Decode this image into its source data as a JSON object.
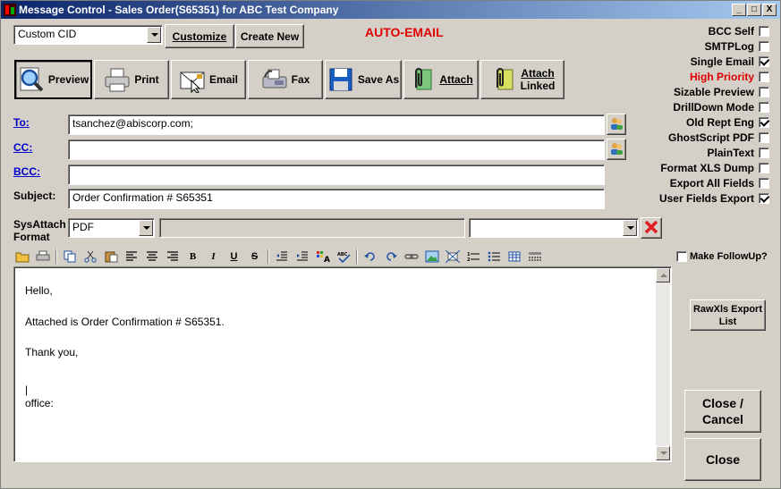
{
  "window": {
    "title": "Message Control - Sales Order(S65351) for ABC Test Company",
    "minimize": "_",
    "maximize": "□",
    "close": "X"
  },
  "top": {
    "cid_select": "Custom CID",
    "customize_label": "Customize",
    "create_new_label": "Create New",
    "auto_email": "AUTO-EMAIL"
  },
  "actions": {
    "preview": "Preview",
    "print": "Print",
    "email": "Email",
    "fax": "Fax",
    "save_as": "Save As",
    "attach": "Attach",
    "attach_linked_1": "Attach",
    "attach_linked_2": "Linked"
  },
  "fields": {
    "to_label": "To:",
    "to_value": "tsanchez@abiscorp.com;",
    "cc_label": "CC:",
    "cc_value": "",
    "bcc_label": "BCC:",
    "bcc_value": "",
    "subject_label": "Subject:",
    "subject_value": "Order Confirmation # S65351",
    "sysattach_label_1": "SysAttach",
    "sysattach_label_2": "Format",
    "format_value": "PDF",
    "attach_path": "",
    "attach_select": ""
  },
  "options": [
    {
      "label": "BCC Self",
      "checked": false,
      "color": "#000000"
    },
    {
      "label": "SMTPLog",
      "checked": false,
      "color": "#000000"
    },
    {
      "label": "Single Email",
      "checked": true,
      "color": "#000000"
    },
    {
      "label": "High Priority",
      "checked": false,
      "color": "#e00000"
    },
    {
      "label": "Sizable Preview",
      "checked": false,
      "color": "#000000"
    },
    {
      "label": "DrillDown Mode",
      "checked": false,
      "color": "#000000"
    },
    {
      "label": "Old Rept Eng",
      "checked": true,
      "color": "#000000"
    },
    {
      "label": "GhostScript PDF",
      "checked": false,
      "color": "#000000"
    },
    {
      "label": "PlainText",
      "checked": false,
      "color": "#000000"
    },
    {
      "label": "Format XLS Dump",
      "checked": false,
      "color": "#000000"
    },
    {
      "label": "Export All Fields",
      "checked": false,
      "color": "#000000"
    },
    {
      "label": "User Fields Export",
      "checked": true,
      "color": "#000000"
    }
  ],
  "followup": {
    "label": "Make FollowUp?",
    "checked": false
  },
  "editor": {
    "line1": "Hello,",
    "line2": "Attached is Order Confirmation # S65351.",
    "line3": "Thank you,",
    "line4": "|",
    "line5": "office:"
  },
  "toolbar": {
    "bold": "B",
    "italic": "I",
    "underline": "U",
    "strike": "S"
  },
  "right_buttons": {
    "rawxls_1": "RawXls Export",
    "rawxls_2": "List",
    "close_cancel_1": "Close /",
    "close_cancel_2": "Cancel",
    "close": "Close"
  }
}
